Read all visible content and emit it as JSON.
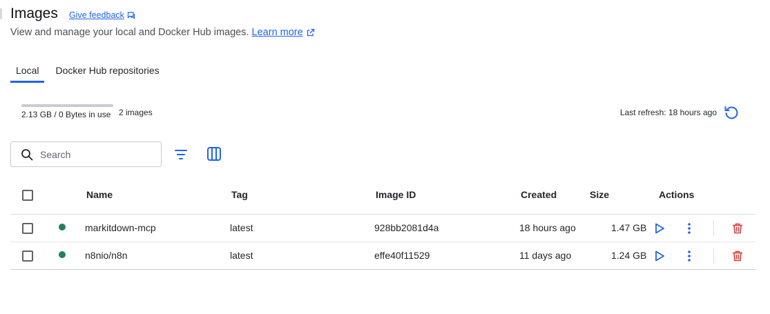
{
  "header": {
    "title": "Images",
    "feedback_label": "Give feedback",
    "subtitle": "View and manage your local and Docker Hub images.",
    "learn_more_label": "Learn more"
  },
  "tabs": [
    {
      "label": "Local",
      "active": true
    },
    {
      "label": "Docker Hub repositories",
      "active": false
    }
  ],
  "storage": {
    "usage_text": "2.13 GB / 0 Bytes in use",
    "usage_fraction": 0,
    "image_count": "2 images"
  },
  "refresh": {
    "label": "Last refresh: 18 hours ago"
  },
  "search": {
    "placeholder": "Search",
    "value": ""
  },
  "table": {
    "columns": [
      "Name",
      "Tag",
      "Image ID",
      "Created",
      "Size",
      "Actions"
    ],
    "rows": [
      {
        "name": "markitdown-mcp",
        "tag": "latest",
        "image_id": "928bb2081d4a",
        "created": "18 hours ago",
        "size": "1.47 GB",
        "status": "in-use"
      },
      {
        "name": "n8nio/n8n",
        "tag": "latest",
        "image_id": "effe40f11529",
        "created": "11 days ago",
        "size": "1.24 GB",
        "status": "in-use"
      }
    ]
  },
  "colors": {
    "accent": "#1d63ed",
    "status_dot": "#21805e",
    "delete": "#d93a3a"
  },
  "icons": {
    "feedback": "feedback-chat-icon",
    "learn_more": "external-link-icon",
    "refresh": "refresh-icon",
    "search": "search-icon",
    "filter": "filter-icon",
    "columns": "columns-icon",
    "run": "play-icon",
    "more": "more-vertical-icon",
    "delete": "trash-icon"
  }
}
